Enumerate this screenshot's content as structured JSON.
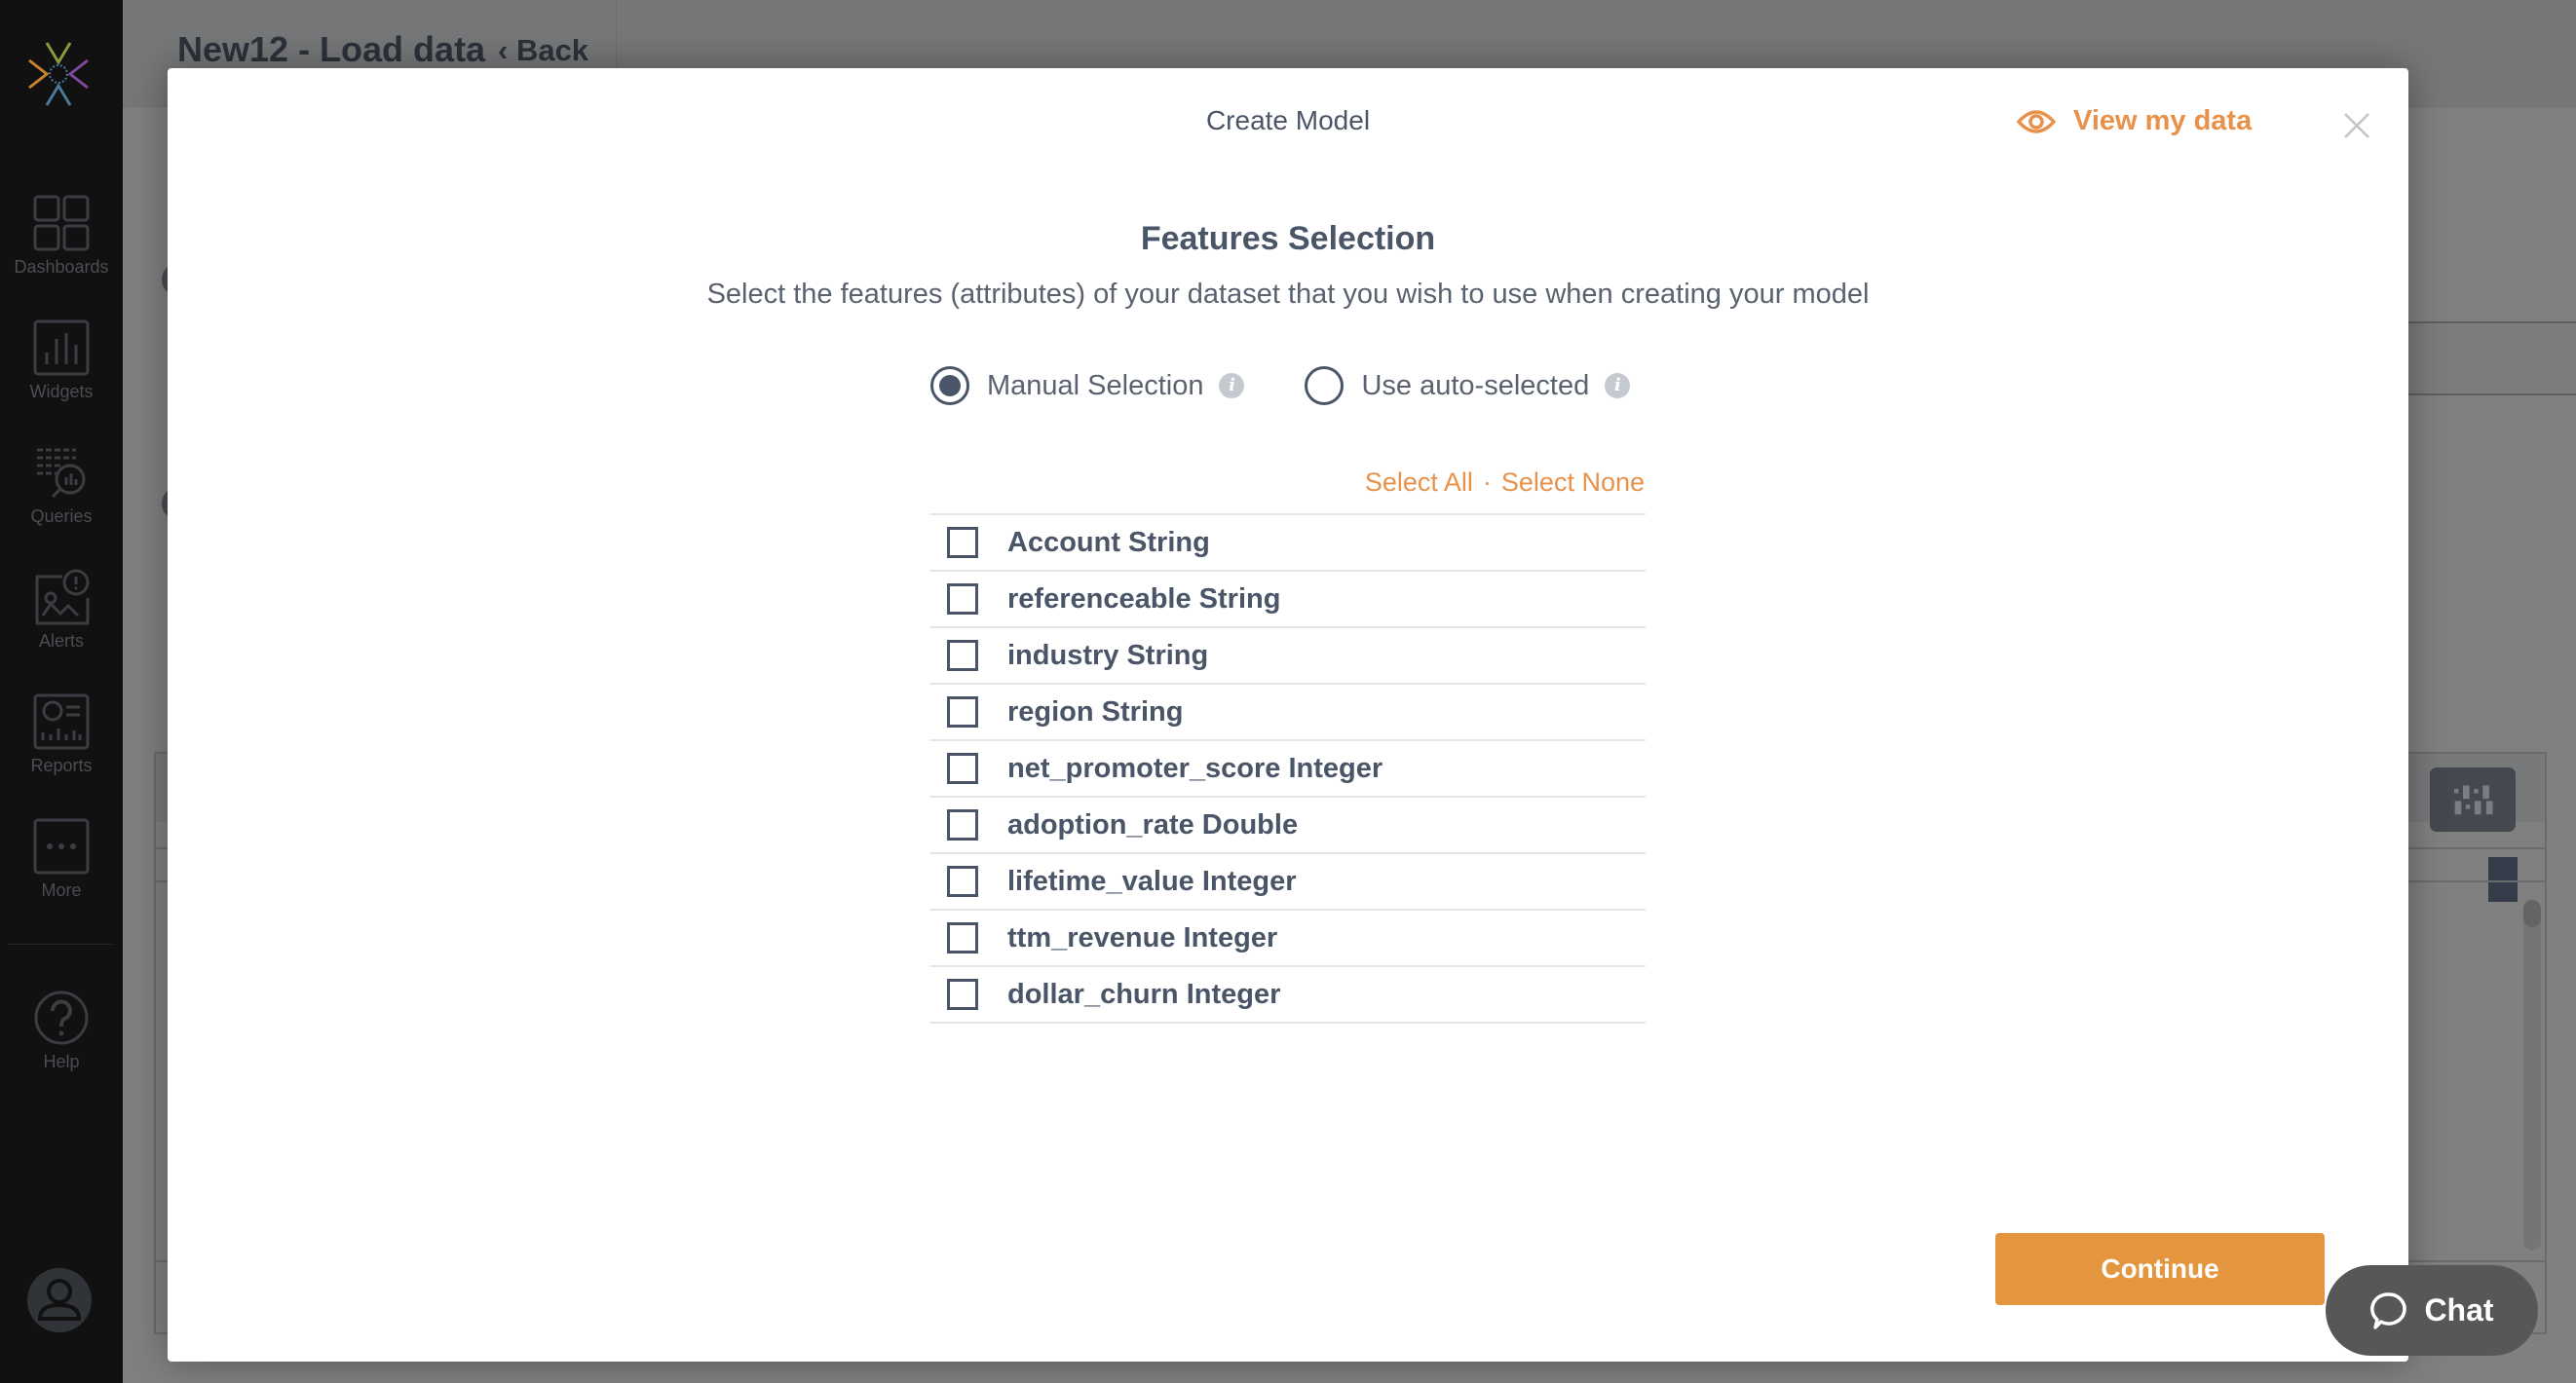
{
  "sidebar": {
    "items": [
      {
        "label": "Dashboards",
        "icon": "dashboards-icon"
      },
      {
        "label": "Widgets",
        "icon": "widgets-icon"
      },
      {
        "label": "Queries",
        "icon": "queries-icon"
      },
      {
        "label": "Alerts",
        "icon": "alerts-icon"
      },
      {
        "label": "Reports",
        "icon": "reports-icon"
      },
      {
        "label": "More",
        "icon": "more-icon"
      }
    ],
    "help": {
      "label": "Help",
      "icon": "help-icon"
    }
  },
  "background": {
    "title": "New12 - Load data",
    "back_label": "Back"
  },
  "modal": {
    "title": "Create Model",
    "view_data_label": "View my data",
    "section_title": "Features Selection",
    "section_subtitle": "Select the features (attributes) of your dataset that you wish to use when creating your model",
    "radios": [
      {
        "label": "Manual Selection",
        "checked": true
      },
      {
        "label": "Use auto-selected",
        "checked": false
      }
    ],
    "select_all_label": "Select All",
    "separator": "·",
    "select_none_label": "Select None",
    "features": [
      {
        "label": "Account String",
        "checked": false
      },
      {
        "label": "referenceable String",
        "checked": false
      },
      {
        "label": "industry String",
        "checked": false
      },
      {
        "label": "region String",
        "checked": false
      },
      {
        "label": "net_promoter_score Integer",
        "checked": false
      },
      {
        "label": "adoption_rate Double",
        "checked": false
      },
      {
        "label": "lifetime_value Integer",
        "checked": false
      },
      {
        "label": "ttm_revenue Integer",
        "checked": false
      },
      {
        "label": "dollar_churn Integer",
        "checked": false
      }
    ],
    "continue_label": "Continue"
  },
  "chat": {
    "label": "Chat"
  },
  "colors": {
    "accent": "#e8914a",
    "button": "#e4963e",
    "text": "#4a5568",
    "sidebar_bg": "#111111",
    "chat_bg": "#575757"
  }
}
